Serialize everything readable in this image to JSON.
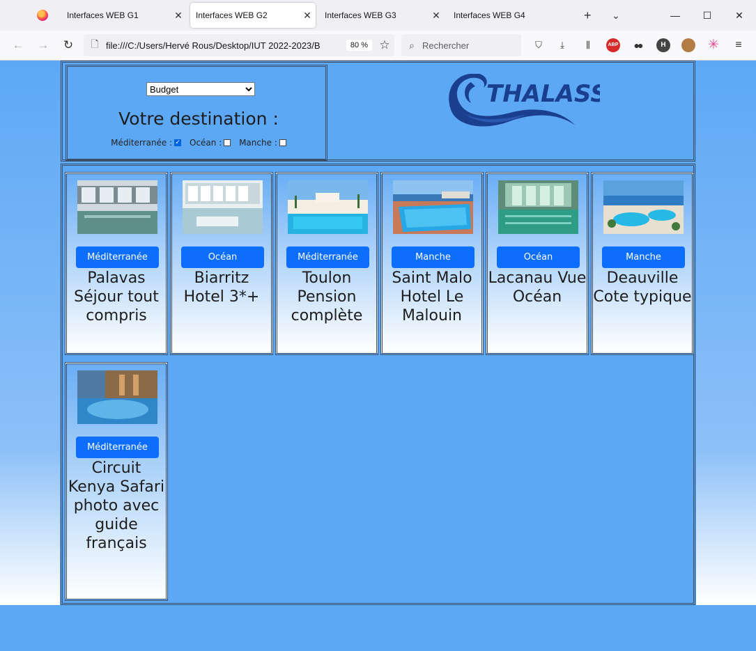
{
  "browser": {
    "tabs": [
      {
        "label": "Interfaces WEB G1",
        "active": false
      },
      {
        "label": "Interfaces WEB G2",
        "active": true
      },
      {
        "label": "Interfaces WEB G3",
        "active": false
      },
      {
        "label": "Interfaces WEB G4",
        "active": false
      }
    ],
    "url": "file:///C:/Users/Hervé Rous/Desktop/IUT 2022-2023/B",
    "zoom": "80 %",
    "search_placeholder": "Rechercher",
    "extensions": {
      "abp": "ABP",
      "h": "H"
    }
  },
  "page": {
    "filter": {
      "select_value": "Budget",
      "title": "Votre destination :",
      "options": [
        {
          "label": "Méditerranée :",
          "checked": true
        },
        {
          "label": "Océan :",
          "checked": false
        },
        {
          "label": "Manche :",
          "checked": false
        }
      ]
    },
    "logo": {
      "text": "THALASSO",
      "color": "#1b3f8f"
    },
    "accent_color": "#0d6efd",
    "cards": [
      {
        "region": "Méditerranée",
        "title": "Palavas Séjour tout compris",
        "image": "indoor-pool-icon"
      },
      {
        "region": "Océan",
        "title": "Biarritz Hotel 3*+",
        "image": "indoor-pool-icon"
      },
      {
        "region": "Méditerranée",
        "title": "Toulon Pension complète",
        "image": "resort-pool-icon"
      },
      {
        "region": "Manche",
        "title": "Saint Malo Hotel Le Malouin",
        "image": "seaside-pool-icon"
      },
      {
        "region": "Océan",
        "title": "Lacanau Vue Océan",
        "image": "indoor-pool-icon"
      },
      {
        "region": "Manche",
        "title": "Deauville Cote typique",
        "image": "resort-pool-icon"
      },
      {
        "region": "Méditerranée",
        "title": "Circuit Kenya Safari photo avec guide français",
        "image": "spa-pool-icon"
      }
    ]
  }
}
